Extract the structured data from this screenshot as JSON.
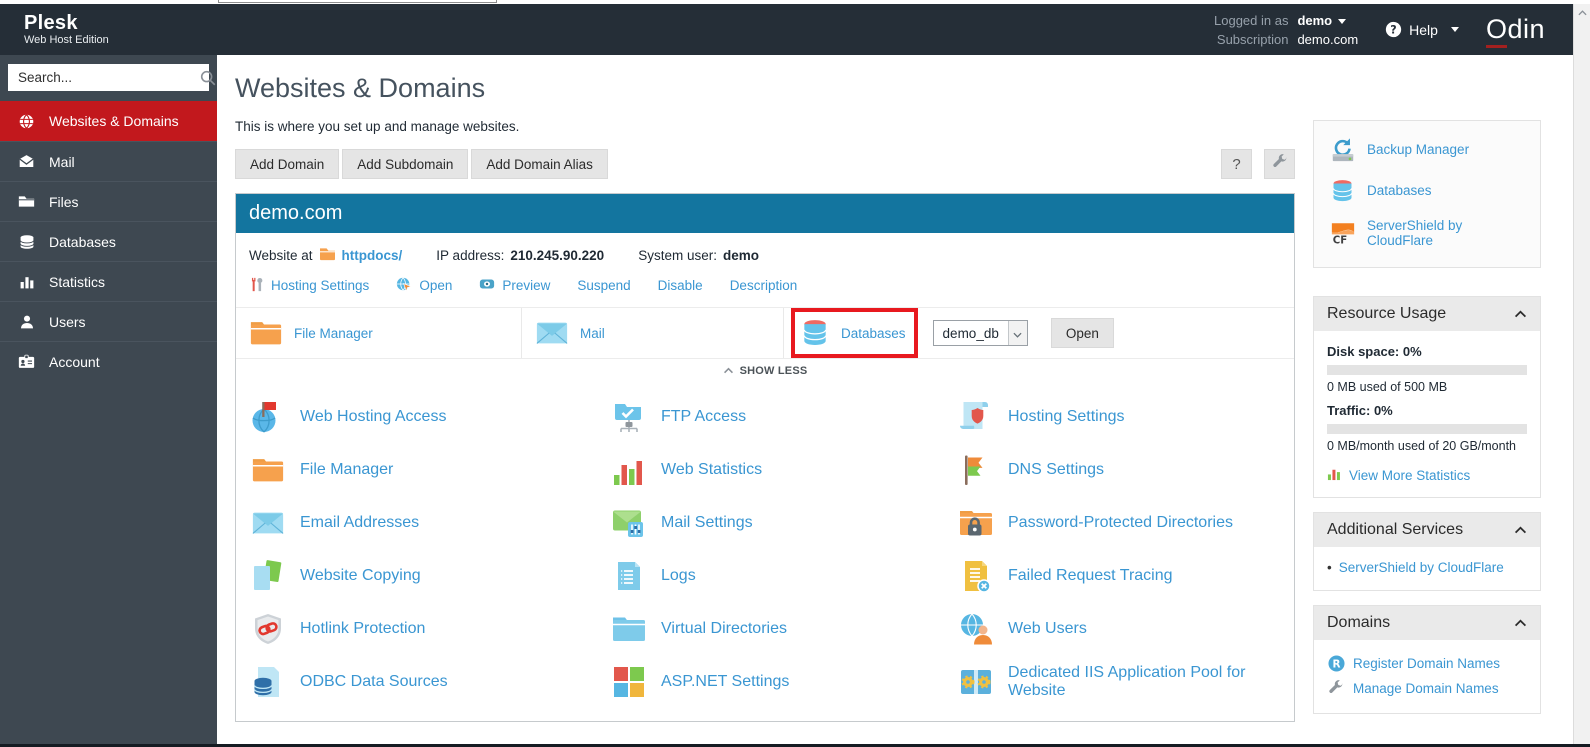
{
  "header": {
    "product_name": "Plesk",
    "edition": "Web Host Edition",
    "logged_in_label": "Logged in as",
    "logged_in_user": "demo",
    "subscription_label": "Subscription",
    "subscription_value": "demo.com",
    "help_label": "Help",
    "brand_initial": "O",
    "brand_rest": "din"
  },
  "sidebar": {
    "search_placeholder": "Search...",
    "items": [
      {
        "label": "Websites & Domains",
        "icon": "globe-icon",
        "active": true
      },
      {
        "label": "Mail",
        "icon": "mail-icon",
        "active": false
      },
      {
        "label": "Files",
        "icon": "folder-icon",
        "active": false
      },
      {
        "label": "Databases",
        "icon": "database-icon",
        "active": false
      },
      {
        "label": "Statistics",
        "icon": "stats-icon",
        "active": false
      },
      {
        "label": "Users",
        "icon": "user-icon",
        "active": false
      },
      {
        "label": "Account",
        "icon": "id-card-icon",
        "active": false
      }
    ]
  },
  "main": {
    "title": "Websites & Domains",
    "subtitle": "This is where you set up and manage websites.",
    "toolbar": {
      "add_domain": "Add Domain",
      "add_subdomain": "Add Subdomain",
      "add_domain_alias": "Add Domain Alias",
      "help": "?"
    },
    "domain_card": {
      "name": "demo.com",
      "website_at_label": "Website at",
      "webroot_link": "httpdocs/",
      "ip_label": "IP address:",
      "ip_value": "210.245.90.220",
      "system_user_label": "System user:",
      "system_user_value": "demo",
      "actions": [
        {
          "label": "Hosting Settings",
          "icon": "wrench-pair-icon"
        },
        {
          "label": "Open",
          "icon": "open-globe-icon"
        },
        {
          "label": "Preview",
          "icon": "preview-icon"
        },
        {
          "label": "Suspend",
          "icon": ""
        },
        {
          "label": "Disable",
          "icon": ""
        },
        {
          "label": "Description",
          "icon": ""
        }
      ],
      "quick_access": {
        "file_manager": "File Manager",
        "mail": "Mail",
        "databases": "Databases",
        "db_select_value": "demo_db",
        "open_button": "Open"
      },
      "show_less_label": "SHOW LESS",
      "tools": [
        {
          "label": "Web Hosting Access",
          "icon": "globe-flag-icon"
        },
        {
          "label": "FTP Access",
          "icon": "folder-network-icon"
        },
        {
          "label": "Hosting Settings",
          "icon": "scroll-shield-icon"
        },
        {
          "label": "File Manager",
          "icon": "folder-orange-icon"
        },
        {
          "label": "Web Statistics",
          "icon": "bar-chart-icon"
        },
        {
          "label": "DNS Settings",
          "icon": "flags-icon"
        },
        {
          "label": "Email Addresses",
          "icon": "envelope-icon"
        },
        {
          "label": "Mail Settings",
          "icon": "envelope-sliders-icon"
        },
        {
          "label": "Password-Protected Directories",
          "icon": "folder-lock-icon"
        },
        {
          "label": "Website Copying",
          "icon": "copy-pages-icon"
        },
        {
          "label": "Logs",
          "icon": "log-page-icon"
        },
        {
          "label": "Failed Request Tracing",
          "icon": "page-error-icon"
        },
        {
          "label": "Hotlink Protection",
          "icon": "shield-chain-icon"
        },
        {
          "label": "Virtual Directories",
          "icon": "folder-blue-icon"
        },
        {
          "label": "Web Users",
          "icon": "globe-user-icon"
        },
        {
          "label": "ODBC Data Sources",
          "icon": "page-database-icon"
        },
        {
          "label": "ASP.NET Settings",
          "icon": "ms-squares-icon"
        },
        {
          "label": "Dedicated IIS Application Pool for Website",
          "icon": "iis-gears-icon"
        }
      ]
    }
  },
  "right_panel": {
    "favorites": [
      {
        "label": "Backup Manager",
        "icon": "backup-icon"
      },
      {
        "label": "Databases",
        "icon": "database-color-icon"
      },
      {
        "label": "ServerShield by CloudFlare",
        "icon": "cloudflare-icon"
      }
    ],
    "resource_usage": {
      "title": "Resource Usage",
      "disk_label": "Disk space: 0%",
      "disk_percent": 0,
      "disk_caption": "0 MB used of 500 MB",
      "traffic_label": "Traffic: 0%",
      "traffic_percent": 0,
      "traffic_caption": "0 MB/month used of 20 GB/month",
      "view_more_label": "View More Statistics"
    },
    "additional_services": {
      "title": "Additional Services",
      "items": [
        {
          "label": "ServerShield by CloudFlare"
        }
      ]
    },
    "domains": {
      "title": "Domains",
      "items": [
        {
          "label": "Register Domain Names",
          "icon": "register-icon"
        },
        {
          "label": "Manage Domain Names",
          "icon": "wrench-icon"
        }
      ]
    }
  },
  "colors": {
    "accent_red": "#c2181d",
    "card_header_blue": "#13759f",
    "link_blue": "#3a96d2",
    "highlight_red": "#e8191f",
    "header_dark": "#252e37",
    "sidebar_dark": "#3e4851"
  }
}
